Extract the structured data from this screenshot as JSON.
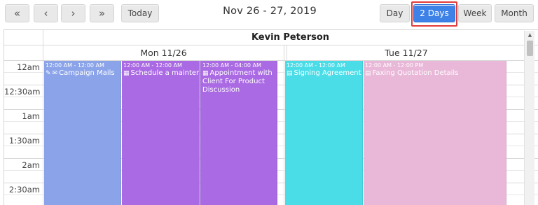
{
  "toolbar": {
    "first_icon": "«",
    "prev_icon": "‹",
    "next_icon": "›",
    "last_icon": "»",
    "today_label": "Today",
    "date_range": "Nov 26 - 27, 2019",
    "views": {
      "day": "Day",
      "two_days": "2 Days",
      "week": "Week",
      "month": "Month"
    },
    "active_view": "2 Days",
    "accent_color": "#3e82e8",
    "highlight_color": "#e23b3b"
  },
  "scheduler": {
    "resource": "Kevin Peterson",
    "days": [
      "Mon 11/26",
      "Tue 11/27"
    ],
    "times": [
      "12am",
      "12:30am",
      "1am",
      "1:30am",
      "2am",
      "2:30am"
    ]
  },
  "events": [
    {
      "time": "12:00 AM - 12:00 AM",
      "icons": [
        "paperclip-icon",
        "envelope-icon"
      ],
      "subject": "Campaign Mails",
      "color": "#8ba4e9"
    },
    {
      "time": "12:00 AM - 12:00 AM",
      "icons": [
        "calendar-icon"
      ],
      "subject": "Schedule a maintenance",
      "color": "#aa6ae3"
    },
    {
      "time": "12:00 AM - 04:00 AM",
      "icons": [
        "calendar-icon"
      ],
      "subject": "Appointment with Client For Product Discussion",
      "color": "#aa6ae3"
    },
    {
      "time": "12:00 AM - 12:00 AM",
      "icons": [
        "document-icon"
      ],
      "subject": "Signing Agreement Letter",
      "color": "#4adde8"
    },
    {
      "time": "12:00 AM - 12:00 PM",
      "icons": [
        "document-icon"
      ],
      "subject": "Faxing Quotation Details",
      "color": "#e9b7d8"
    }
  ]
}
